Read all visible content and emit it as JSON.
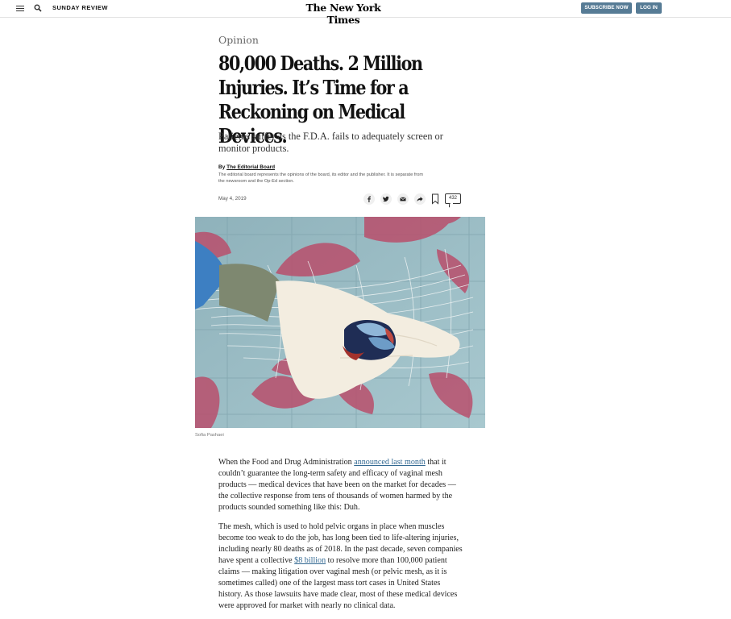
{
  "header": {
    "section": "SUNDAY REVIEW",
    "masthead": "The New York Times",
    "subscribe_label": "SUBSCRIBE NOW",
    "login_label": "LOG IN",
    "accent_color": "#567b95"
  },
  "article": {
    "kicker": "Opinion",
    "headline": "80,000 Deaths. 2 Million Injuries. It’s Time for a Reckoning on Medical Devices.",
    "summary": "Patients suffer as the F.D.A. fails to adequately screen or monitor products.",
    "byline_prefix": "By ",
    "byline_author": "The Editorial Board",
    "byline_description": "The editorial board represents the opinions of the board, its editor and the publisher. It is separate from the newsroom and the Op-Ed section.",
    "date": "May 4, 2019",
    "comment_count": "432",
    "share_icons": [
      "facebook-icon",
      "twitter-icon",
      "email-icon",
      "share-icon",
      "bookmark-icon",
      "comment-icon"
    ],
    "image_credit": "Sofia Pashaei"
  },
  "body": {
    "p1_before": "When the Food and Drug Administration ",
    "p1_link": "announced last month",
    "p1_after": " that it couldn’t guarantee the long-term safety and efficacy of vaginal mesh products — medical devices that have been on the market for decades — the collective response from tens of thousands of women harmed by the products sounded something like this: Duh.",
    "p2_before": "The mesh, which is used to hold pelvic organs in place when muscles become too weak to do the job, has long been tied to life-altering injuries, including nearly 80 deaths as of 2018. In the past decade, seven companies have spent a collective ",
    "p2_link": "$8 billion",
    "p2_after": " to resolve more than 100,000 patient claims — making litigation over vaginal mesh (or pelvic mesh, as it is sometimes called) one of the largest mass tort cases in United States history. As those lawsuits have made clear, most of these medical devices were approved for market with nearly no clinical data."
  }
}
